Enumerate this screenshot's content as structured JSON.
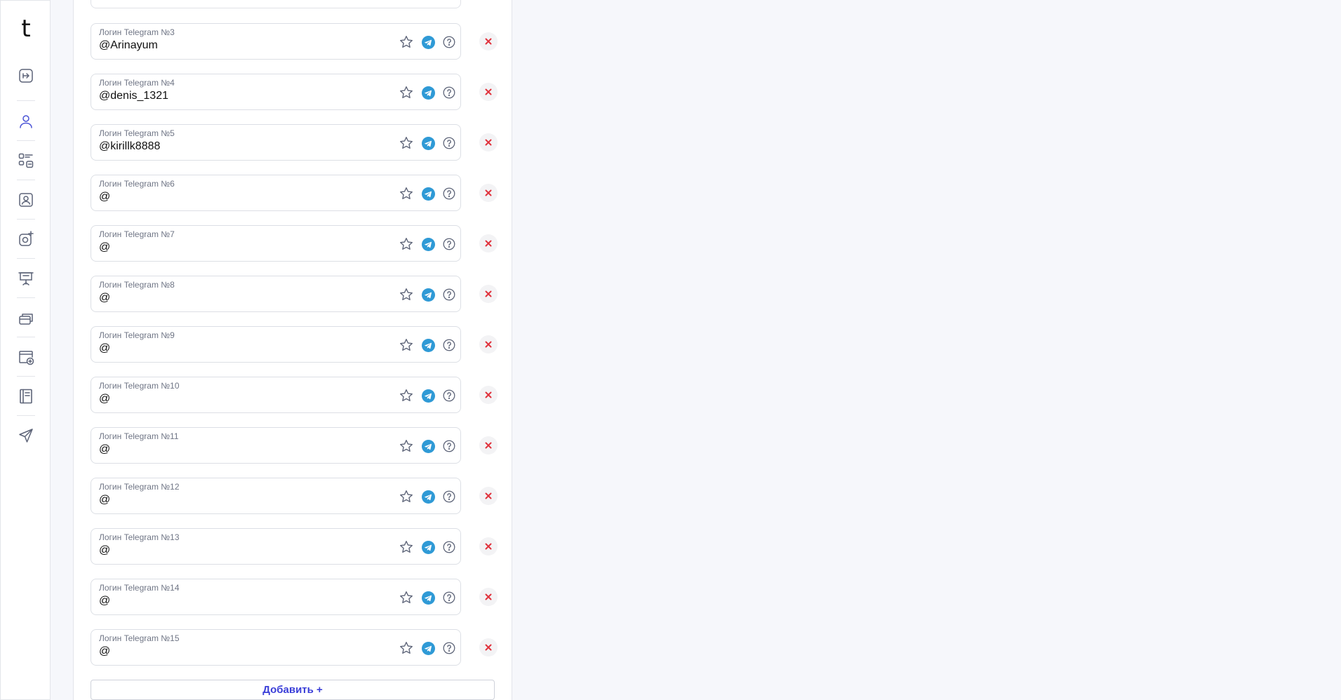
{
  "logo": "t",
  "sidebar": {
    "items": [
      {
        "icon": "logout-icon"
      },
      {
        "icon": "user-icon"
      },
      {
        "icon": "structure-icon"
      },
      {
        "icon": "contact-card-icon"
      },
      {
        "icon": "add-media-icon"
      },
      {
        "icon": "presentation-icon"
      },
      {
        "icon": "cards-icon"
      },
      {
        "icon": "add-window-icon"
      },
      {
        "icon": "document-icon"
      },
      {
        "icon": "send-icon"
      }
    ],
    "active_color": "#4b54d6",
    "icon_color": "#5d6478"
  },
  "telegram_logins": [
    {
      "label": "Логин Telegram №3",
      "value": "@Arinayum"
    },
    {
      "label": "Логин Telegram №4",
      "value": "@denis_1321"
    },
    {
      "label": "Логин Telegram №5",
      "value": "@kirillk8888"
    },
    {
      "label": "Логин Telegram №6",
      "value": "@"
    },
    {
      "label": "Логин Telegram №7",
      "value": "@"
    },
    {
      "label": "Логин Telegram №8",
      "value": "@"
    },
    {
      "label": "Логин Telegram №9",
      "value": "@"
    },
    {
      "label": "Логин Telegram №10",
      "value": "@"
    },
    {
      "label": "Логин Telegram №11",
      "value": "@"
    },
    {
      "label": "Логин Telegram №12",
      "value": "@"
    },
    {
      "label": "Логин Telegram №13",
      "value": "@"
    },
    {
      "label": "Логин Telegram №14",
      "value": "@"
    },
    {
      "label": "Логин Telegram №15",
      "value": "@"
    }
  ],
  "add_button_label": "Добавить +",
  "colors": {
    "telegram": "#2f9ad6",
    "remove": "#e0323c",
    "accent": "#3b3fd8"
  }
}
